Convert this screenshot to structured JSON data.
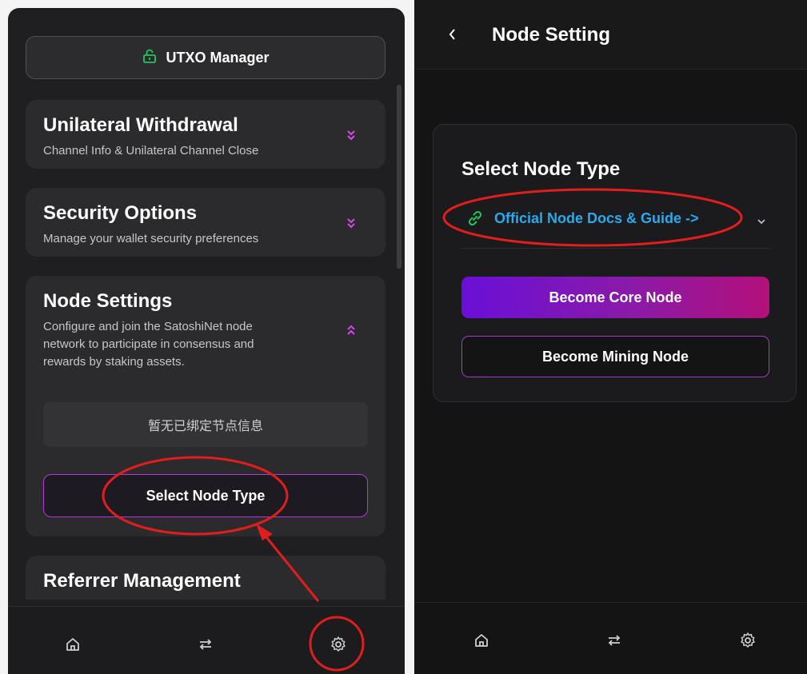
{
  "left": {
    "utxo_manager": {
      "label": "UTXO Manager",
      "icon": "lock-open-icon",
      "icon_color": "#22c55e"
    },
    "cards": [
      {
        "title": "Unilateral Withdrawal",
        "description": "Channel Info & Unilateral Channel Close",
        "state": "collapsed"
      },
      {
        "title": "Security Options",
        "description": "Manage your wallet security preferences",
        "state": "collapsed"
      },
      {
        "title": "Node Settings",
        "description_lines": [
          "Configure and join the SatoshiNet node",
          "network to participate in consensus and",
          "rewards by staking assets."
        ],
        "state": "expanded",
        "empty_text": "暂无已绑定节点信息",
        "select_button": "Select Node Type"
      },
      {
        "title": "Referrer Management"
      }
    ],
    "nav": [
      {
        "name": "home",
        "icon": "home-icon"
      },
      {
        "name": "transfer",
        "icon": "swap-icon"
      },
      {
        "name": "settings",
        "icon": "gear-icon",
        "active": true
      }
    ]
  },
  "right": {
    "header": {
      "title": "Node Setting",
      "back_icon": "chevron-left-icon"
    },
    "node_card": {
      "title": "Select Node Type",
      "docs_link": "Official Node Docs & Guide ->",
      "docs_icon": "link-icon",
      "core_button": "Become Core Node",
      "mining_button": "Become Mining Node"
    },
    "nav": [
      {
        "name": "home",
        "icon": "home-icon"
      },
      {
        "name": "transfer",
        "icon": "swap-icon"
      },
      {
        "name": "settings",
        "icon": "gear-icon"
      }
    ]
  },
  "colors": {
    "accent_purple": "#a23cc6",
    "chevron_pink": "#d946ef",
    "link_blue": "#29a9ee",
    "annotation_red": "#e11d1d"
  }
}
